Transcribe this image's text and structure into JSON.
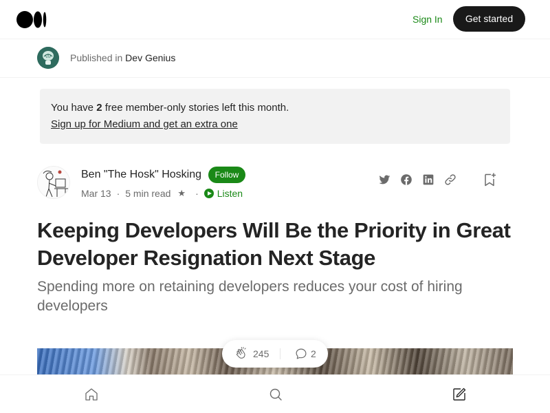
{
  "header": {
    "logo_icon": "medium-logo-icon",
    "signin_label": "Sign In",
    "get_started_label": "Get started"
  },
  "publication": {
    "prefix": "Published in",
    "name": "Dev Genius",
    "avatar_icon": "dev-genius-logo-icon"
  },
  "notice": {
    "text_before": "You have ",
    "count": "2",
    "text_after": " free member-only stories left this month.",
    "link_label": "Sign up for Medium and get an extra one"
  },
  "author": {
    "name": "Ben \"The Hosk\" Hosking",
    "follow_label": "Follow",
    "date": "Mar 13",
    "read_time": "5 min read",
    "member_star": "★",
    "listen_label": "Listen"
  },
  "share": {
    "icons": [
      "twitter-icon",
      "facebook-icon",
      "linkedin-icon",
      "link-icon"
    ],
    "bookmark_icon": "bookmark-add-icon"
  },
  "article": {
    "title": "Keeping Developers Will Be the Priority in Great Developer Resignation Next Stage",
    "subtitle": "Spending more on retaining developers reduces your cost of hiring developers"
  },
  "engagement": {
    "claps": "245",
    "responses": "2"
  },
  "bottom_nav": {
    "icons": [
      "home-icon",
      "search-icon",
      "write-icon"
    ]
  },
  "colors": {
    "accent_green": "#1a8917",
    "dark": "#242424",
    "muted": "#6b6b6b",
    "notice_bg": "#f2f2f2"
  }
}
